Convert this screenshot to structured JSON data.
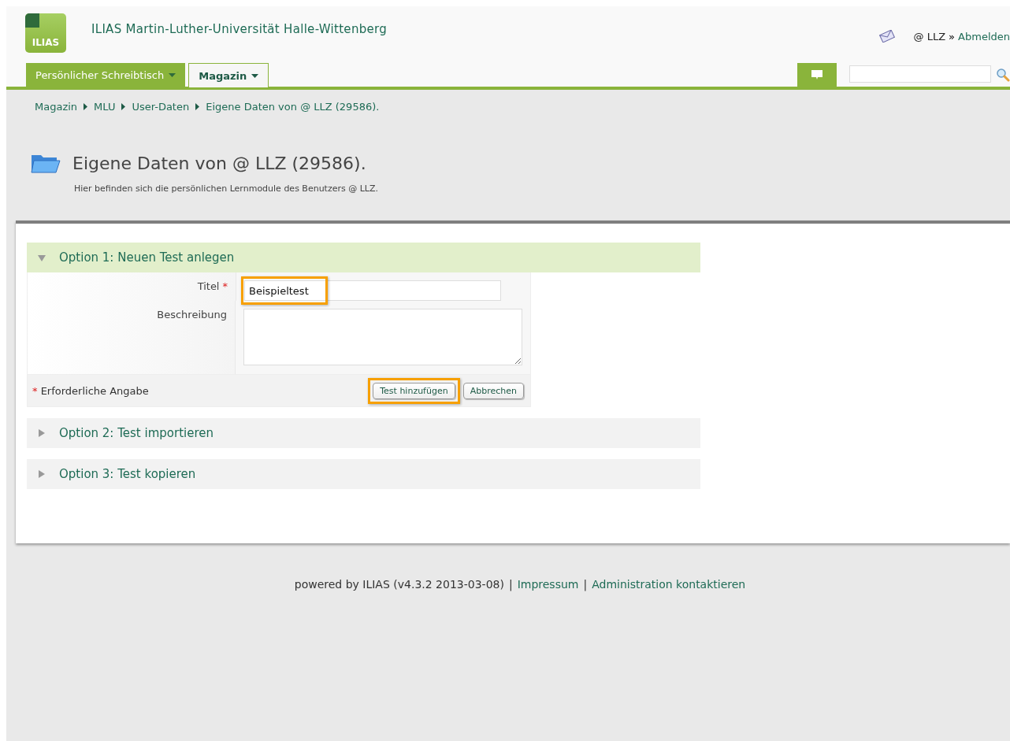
{
  "header": {
    "logo": "ILIAS",
    "title": "ILIAS Martin-Luther-Universität Halle-Wittenberg",
    "user": "@ LLZ",
    "separator": "»",
    "logout": "Abmelden"
  },
  "tabs": [
    {
      "label": "Persönlicher Schreibtisch",
      "selected": false
    },
    {
      "label": "Magazin",
      "selected": true
    }
  ],
  "breadcrumb": [
    "Magazin",
    "MLU",
    "User-Daten",
    "Eigene Daten von @ LLZ (29586)."
  ],
  "page": {
    "title": "Eigene Daten von @ LLZ (29586).",
    "description": "Hier befinden sich die persönlichen Lernmodule des Benutzers @ LLZ."
  },
  "options": [
    {
      "title": "Option 1: Neuen Test anlegen",
      "expanded": true
    },
    {
      "title": "Option 2: Test importieren",
      "expanded": false
    },
    {
      "title": "Option 3: Test kopieren",
      "expanded": false
    }
  ],
  "form": {
    "required_mark": "*",
    "fields": [
      {
        "kind": "text",
        "label": "Titel",
        "required": true,
        "value": "Beispieltest",
        "highlighted": true
      },
      {
        "kind": "textarea",
        "label": "Beschreibung",
        "required": false,
        "highlighted": false
      }
    ],
    "required_note": "Erforderliche Angabe",
    "buttons": [
      {
        "label": "Test hinzufügen",
        "highlighted": true
      },
      {
        "label": "Abbrechen",
        "highlighted": false
      }
    ]
  },
  "footer": [
    {
      "kind": "text",
      "text": "powered by ILIAS (v4.3.2 2013-03-08)"
    },
    {
      "kind": "separator",
      "text": "|"
    },
    {
      "kind": "link",
      "text": "Impressum"
    },
    {
      "kind": "separator",
      "text": "|"
    },
    {
      "kind": "link",
      "text": "Administration kontaktieren"
    }
  ]
}
